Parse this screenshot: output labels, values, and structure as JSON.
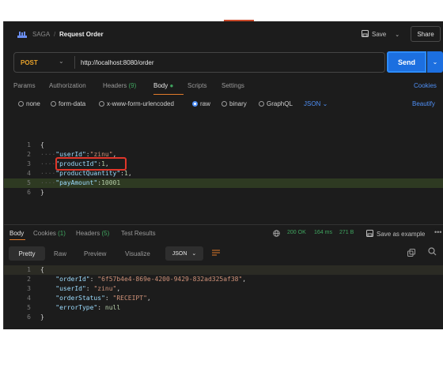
{
  "header": {
    "collection": "SAGA",
    "separator": "/",
    "title": "Request Order",
    "save_label": "Save",
    "share_label": "Share"
  },
  "request": {
    "method": "POST",
    "url": "http://localhost:8080/order",
    "send_label": "Send"
  },
  "tabs": {
    "params": "Params",
    "authorization": "Authorization",
    "headers": "Headers",
    "headers_count": "(9)",
    "body": "Body",
    "scripts": "Scripts",
    "settings": "Settings",
    "cookies": "Cookies"
  },
  "body_types": {
    "none": "none",
    "form_data": "form-data",
    "urlencoded": "x-www-form-urlencoded",
    "raw": "raw",
    "binary": "binary",
    "graphql": "GraphQL",
    "format": "JSON",
    "beautify": "Beautify",
    "selected": "raw"
  },
  "request_body": [
    {
      "n": "1",
      "text": "{"
    },
    {
      "n": "2",
      "key": "\"userId\"",
      "val": "\"zinu\"",
      "vtype": "str",
      "tail": ","
    },
    {
      "n": "3",
      "key": "\"productId\"",
      "val": "1",
      "vtype": "num",
      "tail": ","
    },
    {
      "n": "4",
      "key": "\"productQuantity\"",
      "val": "1",
      "vtype": "num",
      "tail": ","
    },
    {
      "n": "5",
      "key": "\"payAmount\"",
      "val": "10001",
      "vtype": "num",
      "tail": ""
    },
    {
      "n": "6",
      "text": "}"
    }
  ],
  "response": {
    "tabs": {
      "body": "Body",
      "cookies": "Cookies",
      "cookies_count": "(1)",
      "headers": "Headers",
      "headers_count": "(5)",
      "tests": "Test Results"
    },
    "status": "200 OK",
    "time": "164 ms",
    "size": "271 B",
    "save_example": "Save as example",
    "views": {
      "pretty": "Pretty",
      "raw": "Raw",
      "preview": "Preview",
      "visualize": "Visualize",
      "format": "JSON"
    },
    "lines": [
      {
        "n": "1",
        "text": "{"
      },
      {
        "n": "2",
        "key": "\"orderId\"",
        "val": "\"6f57b4e4-869e-4200-9429-832ad325af38\"",
        "vtype": "str",
        "tail": ","
      },
      {
        "n": "3",
        "key": "\"userId\"",
        "val": "\"zinu\"",
        "vtype": "str",
        "tail": ","
      },
      {
        "n": "4",
        "key": "\"orderStatus\"",
        "val": "\"RECEIPT\"",
        "vtype": "str",
        "tail": ","
      },
      {
        "n": "5",
        "key": "\"errorType\"",
        "val": "null",
        "vtype": "num",
        "tail": ""
      },
      {
        "n": "6",
        "text": "}"
      }
    ]
  }
}
